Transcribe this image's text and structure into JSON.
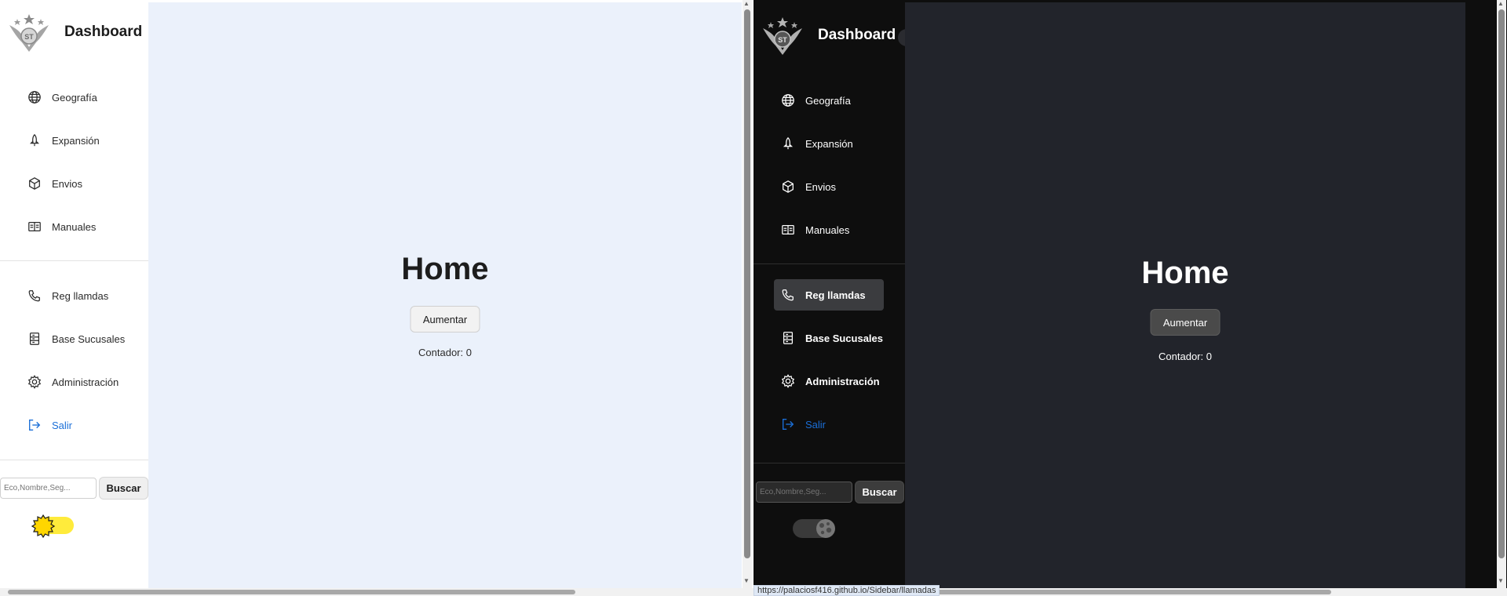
{
  "light": {
    "brand": {
      "title": "Dashboard",
      "collapse_icon": "‹"
    },
    "nav_group_1": [
      {
        "label": "Geografía",
        "icon": "globe-icon"
      },
      {
        "label": "Expansión",
        "icon": "rocket-icon"
      },
      {
        "label": "Envios",
        "icon": "box-icon"
      },
      {
        "label": "Manuales",
        "icon": "book-icon"
      }
    ],
    "nav_group_2": [
      {
        "label": "Reg llamdas",
        "icon": "phone-icon"
      },
      {
        "label": "Base Sucusales",
        "icon": "server-icon"
      },
      {
        "label": "Administración",
        "icon": "gear-icon"
      },
      {
        "label": "Salir",
        "icon": "logout-icon"
      }
    ],
    "search": {
      "placeholder": "Eco,Nombre,Seg...",
      "button": "Buscar"
    },
    "theme_toggle": {
      "state": "light",
      "icon": "sun-icon"
    },
    "main": {
      "title": "Home",
      "button": "Aumentar",
      "counter": "Contador: 0"
    }
  },
  "dark": {
    "brand": {
      "title": "Dashboard",
      "collapse_icon": "‹"
    },
    "nav_group_1": [
      {
        "label": "Geografía",
        "icon": "globe-icon"
      },
      {
        "label": "Expansión",
        "icon": "rocket-icon"
      },
      {
        "label": "Envios",
        "icon": "box-icon"
      },
      {
        "label": "Manuales",
        "icon": "book-icon"
      }
    ],
    "nav_group_2": [
      {
        "label": "Reg llamdas",
        "icon": "phone-icon",
        "active": true
      },
      {
        "label": "Base Sucusales",
        "icon": "server-icon"
      },
      {
        "label": "Administración",
        "icon": "gear-icon"
      },
      {
        "label": "Salir",
        "icon": "logout-icon"
      }
    ],
    "search": {
      "placeholder": "Eco,Nombre,Seg...",
      "button": "Buscar"
    },
    "theme_toggle": {
      "state": "dark",
      "icon": "moon-icon"
    },
    "main": {
      "title": "Home",
      "button": "Aumentar",
      "counter": "Contador: 0"
    },
    "status_url": "https://palaciosf416.github.io/Sidebar/llamadas"
  },
  "colors": {
    "light_main_bg": "#ebf1fb",
    "dark_main_bg": "#22242b",
    "dark_sidebar_bg": "#0e0e0e",
    "logout_accent": "#1b6fd8",
    "toggle_sun": "#ffeb3b"
  }
}
